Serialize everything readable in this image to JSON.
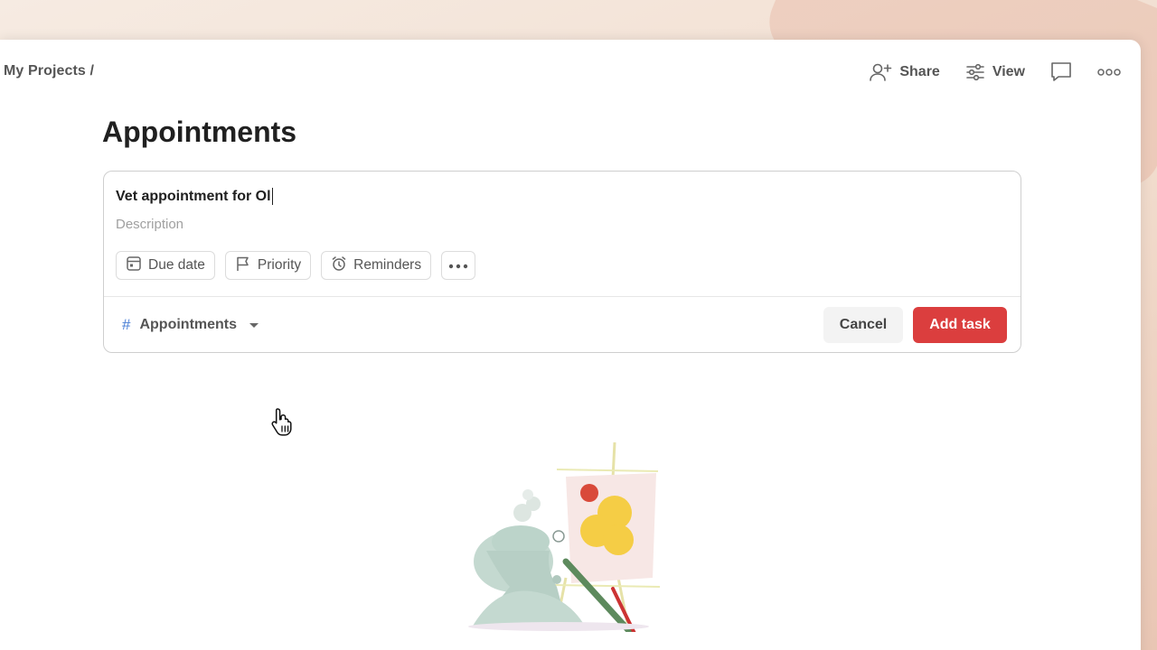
{
  "breadcrumb": "My Projects /",
  "toolbar": {
    "share_label": "Share",
    "view_label": "View",
    "share_icon": "add-person-icon",
    "view_icon": "sliders-icon",
    "comment_icon": "comment-icon",
    "more_icon": "more-horizontal-icon"
  },
  "page": {
    "title": "Appointments"
  },
  "task_editor": {
    "title_value": "Vet appointment for Ol",
    "description_placeholder": "Description",
    "chips": {
      "due_date": "Due date",
      "priority": "Priority",
      "reminders": "Reminders"
    },
    "project": {
      "hash": "#",
      "name": "Appointments"
    },
    "cancel_label": "Cancel",
    "add_label": "Add task"
  },
  "colors": {
    "accent_red": "#db3e3e",
    "hash_blue": "#4a7fd6",
    "text_dark": "#202020",
    "text_muted": "#555555"
  }
}
